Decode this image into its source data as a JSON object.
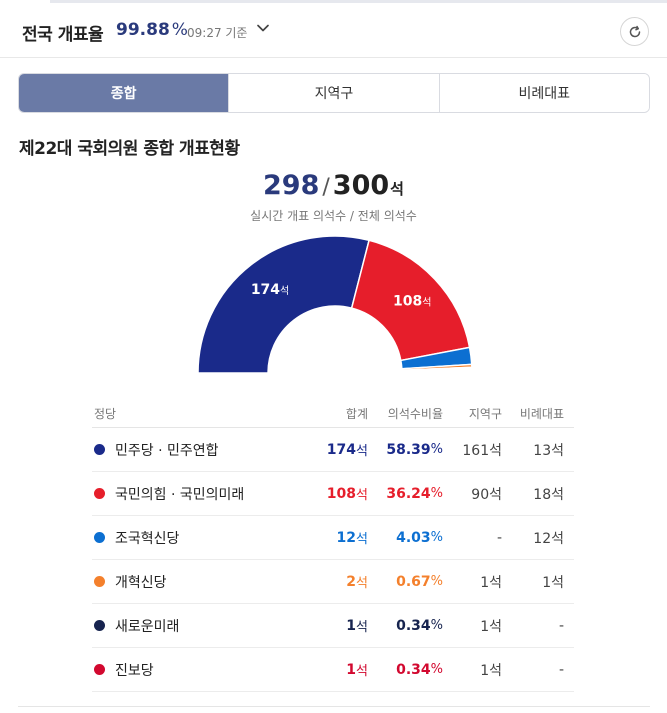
{
  "header": {
    "label": "전국 개표율",
    "rate": "99.88",
    "rate_unit": "%",
    "time": "09:27 기준"
  },
  "tabs": [
    {
      "label": "종합",
      "active": true
    },
    {
      "label": "지역구",
      "active": false
    },
    {
      "label": "비례대표",
      "active": false
    }
  ],
  "section_title": "제22대 국회의원 종합 개표현황",
  "summary": {
    "current": "298",
    "slash": "/",
    "total": "300",
    "unit": "석",
    "caption": "실시간 개표 의석수 / 전체 의석수"
  },
  "chart_data": {
    "type": "pie",
    "total": 300,
    "slices": [
      {
        "party": "민주당 · 민주연합",
        "value": 174,
        "label": "174",
        "color": "#1a2a8a"
      },
      {
        "party": "국민의힘 · 국민의미래",
        "value": 108,
        "label": "108",
        "color": "#e61e2b"
      },
      {
        "party": "조국혁신당",
        "value": 12,
        "color": "#0c6fd1"
      },
      {
        "party": "개혁신당",
        "value": 2,
        "color": "#f4802c"
      },
      {
        "party": "새로운미래",
        "value": 1,
        "color": "#17244f"
      },
      {
        "party": "진보당",
        "value": 1,
        "color": "#d2082f"
      }
    ],
    "label_unit": "석"
  },
  "table": {
    "headers": {
      "party": "정당",
      "total": "합계",
      "ratio": "의석수비율",
      "district": "지역구",
      "proportional": "비례대표"
    },
    "rows": [
      {
        "party": "민주당 · 민주연합",
        "total": "174",
        "total_unit": "석",
        "ratio": "58.39",
        "ratio_unit": "%",
        "district": "161석",
        "proportional": "13석",
        "color": "#1a2a8a"
      },
      {
        "party": "국민의힘 · 국민의미래",
        "total": "108",
        "total_unit": "석",
        "ratio": "36.24",
        "ratio_unit": "%",
        "district": "90석",
        "proportional": "18석",
        "color": "#e61e2b"
      },
      {
        "party": "조국혁신당",
        "total": "12",
        "total_unit": "석",
        "ratio": "4.03",
        "ratio_unit": "%",
        "district": "-",
        "proportional": "12석",
        "color": "#0c6fd1"
      },
      {
        "party": "개혁신당",
        "total": "2",
        "total_unit": "석",
        "ratio": "0.67",
        "ratio_unit": "%",
        "district": "1석",
        "proportional": "1석",
        "color": "#f4802c"
      },
      {
        "party": "새로운미래",
        "total": "1",
        "total_unit": "석",
        "ratio": "0.34",
        "ratio_unit": "%",
        "district": "1석",
        "proportional": "-",
        "color": "#17244f"
      },
      {
        "party": "진보당",
        "total": "1",
        "total_unit": "석",
        "ratio": "0.34",
        "ratio_unit": "%",
        "district": "1석",
        "proportional": "-",
        "color": "#d2082f"
      }
    ]
  },
  "icons": {
    "dropdown": "chevron-down-icon",
    "refresh": "refresh-icon"
  }
}
